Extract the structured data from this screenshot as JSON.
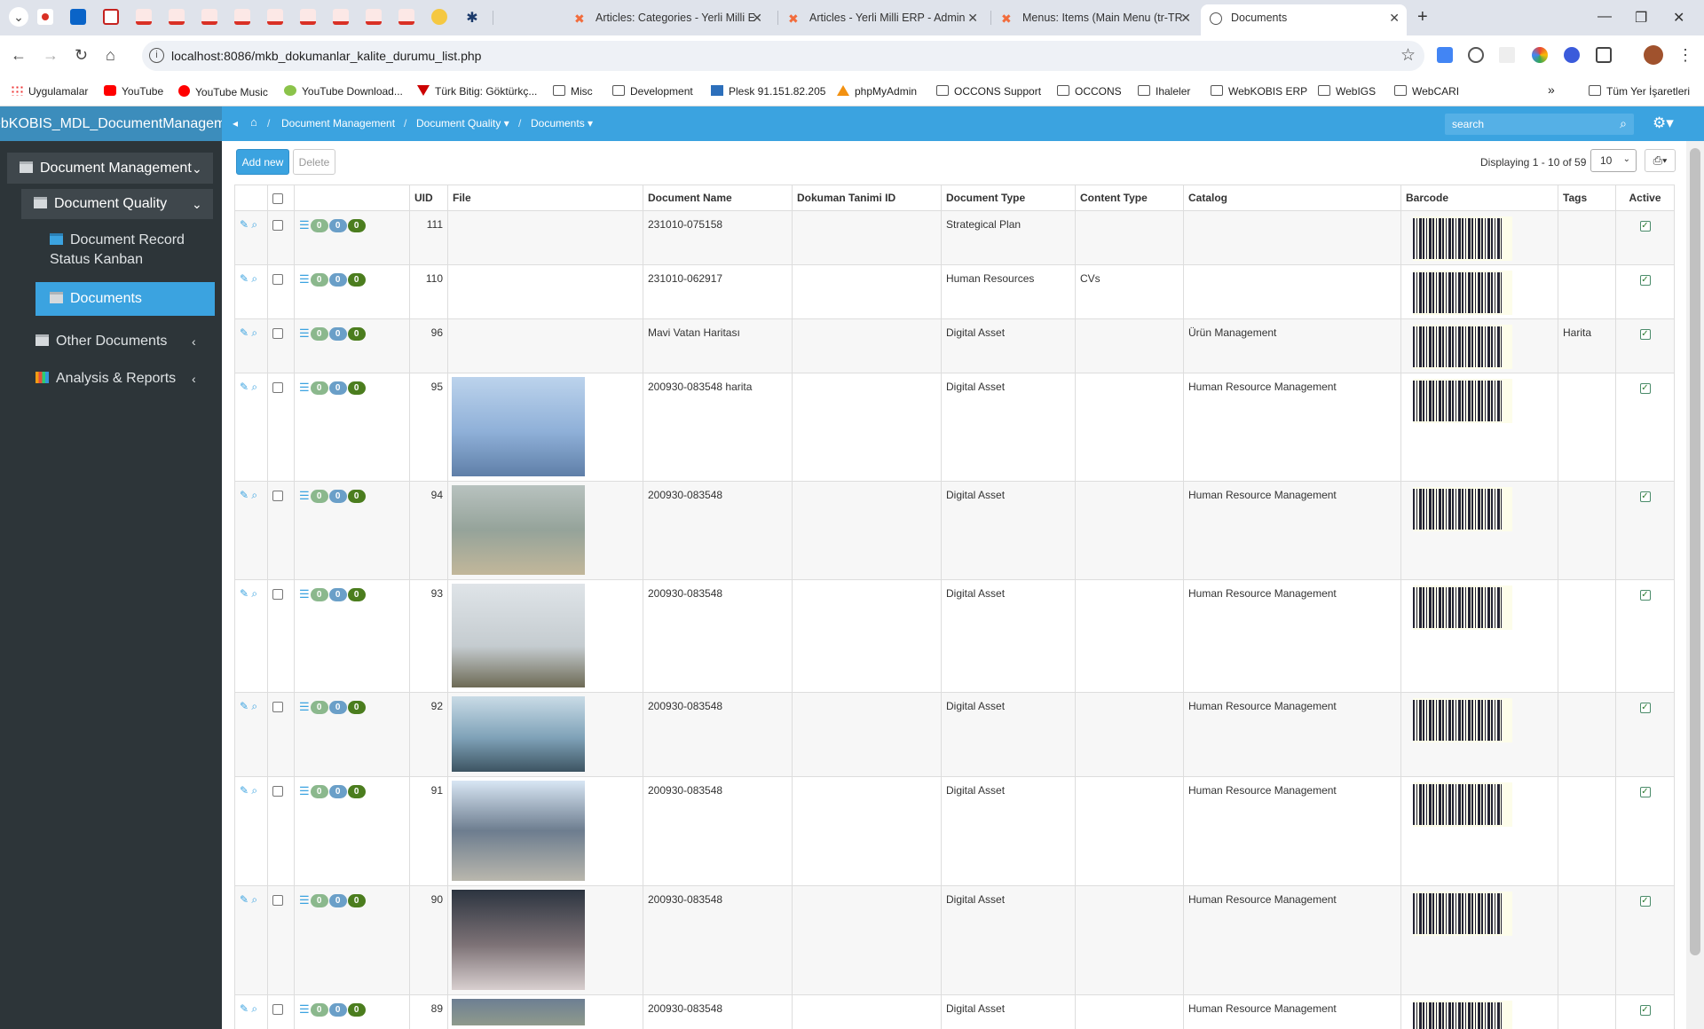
{
  "browser": {
    "tabs": [
      {
        "title": "Articles: Categories - Yerli Milli E"
      },
      {
        "title": "Articles - Yerli Milli ERP - Admin"
      },
      {
        "title": "Menus: Items (Main Menu (tr-TR"
      },
      {
        "title": "Documents"
      }
    ],
    "url": "localhost:8086/mkb_dokumanlar_kalite_durumu_list.php",
    "bookmarks": [
      "Uygulamalar",
      "YouTube",
      "YouTube Music",
      "YouTube Download...",
      "Türk Bitig: Göktürkç...",
      "Misc",
      "Development",
      "Plesk 91.151.82.205",
      "phpMyAdmin",
      "OCCONS Support",
      "OCCONS",
      "Ihaleler",
      "WebKOBIS ERP",
      "WebIGS",
      "WebCARI",
      "Tüm Yer İşaretleri"
    ],
    "overflow": "»"
  },
  "app": {
    "brand": "ebKOBIS_MDL_DocumentManageme",
    "sidebar": {
      "document_management": "Document Management",
      "document_quality": "Document Quality",
      "document_record_status_kanban": "Document Record Status Kanban",
      "documents": "Documents",
      "other_documents": "Other Documents",
      "analysis_reports": "Analysis & Reports"
    },
    "breadcrumb": {
      "sep": "/",
      "item1": "Document Management",
      "item2": "Document Quality",
      "item3": "Documents"
    },
    "search_placeholder": "search"
  },
  "toolbar": {
    "add_new": "Add new",
    "delete": "Delete",
    "displaying": "Displaying 1 - 10 of 59",
    "per_page": "10"
  },
  "table": {
    "columns": [
      "UID",
      "File",
      "Document Name",
      "Dokuman Tanimi ID",
      "Document Type",
      "Content Type",
      "Catalog",
      "Barcode",
      "Tags",
      "Active"
    ],
    "badge_value": "0",
    "rows": [
      {
        "uid": "111",
        "name": "231010-075158",
        "def_id": "",
        "type": "Strategical Plan",
        "content": "",
        "catalog": "",
        "tags": "",
        "has_image": false,
        "image_desc": ""
      },
      {
        "uid": "110",
        "name": "231010-062917",
        "def_id": "",
        "type": "Human Resources",
        "content": "CVs",
        "catalog": "",
        "tags": "",
        "has_image": false,
        "image_desc": ""
      },
      {
        "uid": "96",
        "name": "Mavi Vatan Haritası",
        "def_id": "",
        "type": "Digital Asset",
        "content": "",
        "catalog": "Ürün Management",
        "tags": "Harita",
        "has_image": false,
        "image_desc": ""
      },
      {
        "uid": "95",
        "name": "200930-083548 harita",
        "def_id": "",
        "type": "Digital Asset",
        "content": "",
        "catalog": "Human Resource Management",
        "tags": "",
        "has_image": true,
        "image_desc": "jet-sky"
      },
      {
        "uid": "94",
        "name": "200930-083548",
        "def_id": "",
        "type": "Digital Asset",
        "content": "",
        "catalog": "Human Resource Management",
        "tags": "",
        "has_image": true,
        "image_desc": "jet-ground"
      },
      {
        "uid": "93",
        "name": "200930-083548",
        "def_id": "",
        "type": "Digital Asset",
        "content": "",
        "catalog": "Human Resource Management",
        "tags": "",
        "has_image": true,
        "image_desc": "jet-takeoff"
      },
      {
        "uid": "92",
        "name": "200930-083548",
        "def_id": "",
        "type": "Digital Asset",
        "content": "",
        "catalog": "Human Resource Management",
        "tags": "",
        "has_image": true,
        "image_desc": "helicopter"
      },
      {
        "uid": "91",
        "name": "200930-083548",
        "def_id": "",
        "type": "Digital Asset",
        "content": "",
        "catalog": "Human Resource Management",
        "tags": "",
        "has_image": true,
        "image_desc": "hangar"
      },
      {
        "uid": "90",
        "name": "200930-083548",
        "def_id": "",
        "type": "Digital Asset",
        "content": "",
        "catalog": "Human Resource Management",
        "tags": "",
        "has_image": true,
        "image_desc": "hangar-2"
      },
      {
        "uid": "89",
        "name": "200930-083548",
        "def_id": "",
        "type": "Digital Asset",
        "content": "",
        "catalog": "Human Resource Management",
        "tags": "",
        "has_image": true,
        "image_desc": "field"
      }
    ]
  },
  "colors": {
    "accent": "#3ba3e0",
    "sidebar_bg": "#2d3539",
    "badge_green": "#8bb88d",
    "badge_blue": "#6a9fc8",
    "badge_dark": "#4b7d1e"
  }
}
